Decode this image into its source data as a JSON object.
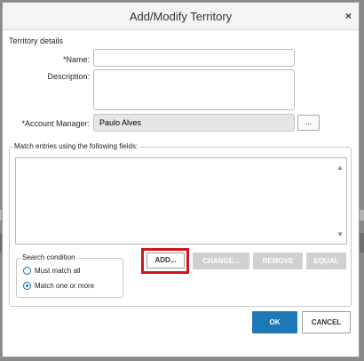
{
  "dialog": {
    "title": "Add/Modify Territory",
    "close_glyph": "×"
  },
  "territory_details": {
    "section_label": "Territory details",
    "name_label": "*Name:",
    "name_value": "",
    "description_label": "Description:",
    "description_value": "",
    "account_manager_label": "*Account Manager:",
    "account_manager_value": "Paulo Alves",
    "browse_label": "..."
  },
  "match_entries": {
    "legend": "Match entries using the following fields:",
    "items": [],
    "scroll_up_glyph": "▲",
    "scroll_down_glyph": "▼"
  },
  "search_condition": {
    "legend": "Search condition",
    "options": [
      {
        "label": "Must match all",
        "selected": false
      },
      {
        "label": "Match one or more",
        "selected": true
      }
    ]
  },
  "buttons": {
    "add": "ADD...",
    "change": "CHANGE...",
    "remove": "REMOVE",
    "equal": "EQUAL",
    "ok": "OK",
    "cancel": "CANCEL"
  },
  "colors": {
    "primary": "#1d79b6",
    "highlight": "#d0141c",
    "disabled": "#d0d0d0"
  }
}
